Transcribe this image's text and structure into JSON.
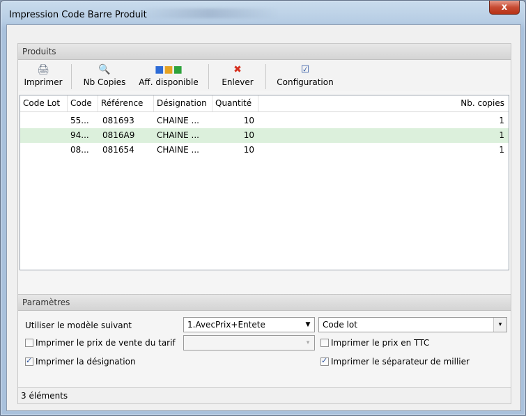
{
  "window": {
    "title": "Impression Code Barre Produit",
    "close_label": "x"
  },
  "produits": {
    "header": "Produits",
    "toolbar": [
      {
        "label": "Imprimer",
        "icon": "printer-icon",
        "glyph": "🖨"
      },
      {
        "label": "Nb Copies",
        "icon": "magnifier-icon",
        "glyph": "🔍"
      },
      {
        "label": "Aff. disponible",
        "icon": "boxes-icon",
        "glyph": "■"
      },
      {
        "label": "Enlever",
        "icon": "red-x-icon",
        "glyph": "✖"
      },
      {
        "label": "Configuration",
        "icon": "checklist-icon",
        "glyph": "☑"
      }
    ],
    "columns": [
      "Code Lot",
      "Code",
      "Référence",
      "Désignation",
      "Quantité",
      "Nb. copies"
    ],
    "rows": [
      {
        "code_lot": "",
        "code": "55...",
        "reference": "081693",
        "designation": "CHAINE ...",
        "quantite": "10",
        "nb_copies": "1",
        "selected": false
      },
      {
        "code_lot": "",
        "code": "94...",
        "reference": "0816A9",
        "designation": "CHAINE ...",
        "quantite": "10",
        "nb_copies": "1",
        "selected": true
      },
      {
        "code_lot": "",
        "code": "08...",
        "reference": "081654",
        "designation": "CHAINE ...",
        "quantite": "10",
        "nb_copies": "1",
        "selected": false
      }
    ]
  },
  "parametres": {
    "header": "Paramètres",
    "modele_label": "Utiliser le modèle suivant",
    "modele_value": "1.AvecPrix+Entete",
    "code_lot_value": "Code lot",
    "prix_vente_label": "Imprimer le prix de vente du tarif",
    "prix_vente_checked": false,
    "tarif_value": "",
    "prix_ttc_label": "Imprimer le prix en TTC",
    "prix_ttc_checked": false,
    "designation_label": "Imprimer la désignation",
    "designation_checked": true,
    "separateur_label": "Imprimer le séparateur de millier",
    "separateur_checked": true
  },
  "status": {
    "text": "3 éléments"
  }
}
